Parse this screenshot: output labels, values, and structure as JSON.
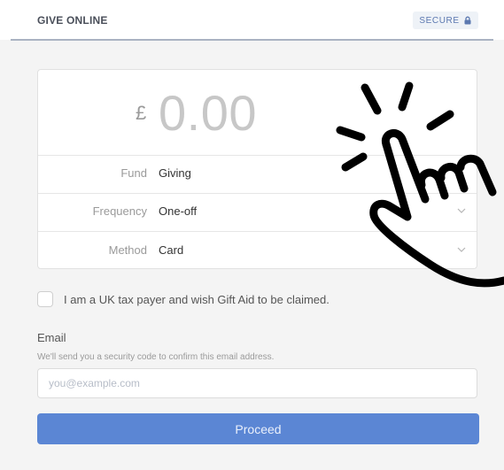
{
  "header": {
    "brand": "GIVE ONLINE",
    "secure_label": "SECURE",
    "secure_icon": "lock-icon"
  },
  "donation": {
    "currency_symbol": "£",
    "amount": "0.00",
    "fund": {
      "label": "Fund",
      "value": "Giving"
    },
    "frequency": {
      "label": "Frequency",
      "value": "One-off"
    },
    "method": {
      "label": "Method",
      "value": "Card"
    }
  },
  "gift_aid": {
    "label": "I am a UK tax payer and wish Gift Aid to be claimed.",
    "checked": false
  },
  "email": {
    "label": "Email",
    "help": "We'll send you a security code to confirm this email address.",
    "placeholder": "you@example.com",
    "value": ""
  },
  "actions": {
    "proceed_label": "Proceed"
  },
  "colors": {
    "accent": "#5b86d4",
    "secure_text": "#5b78b0"
  },
  "overlay": {
    "icon": "tap-hand-icon"
  }
}
